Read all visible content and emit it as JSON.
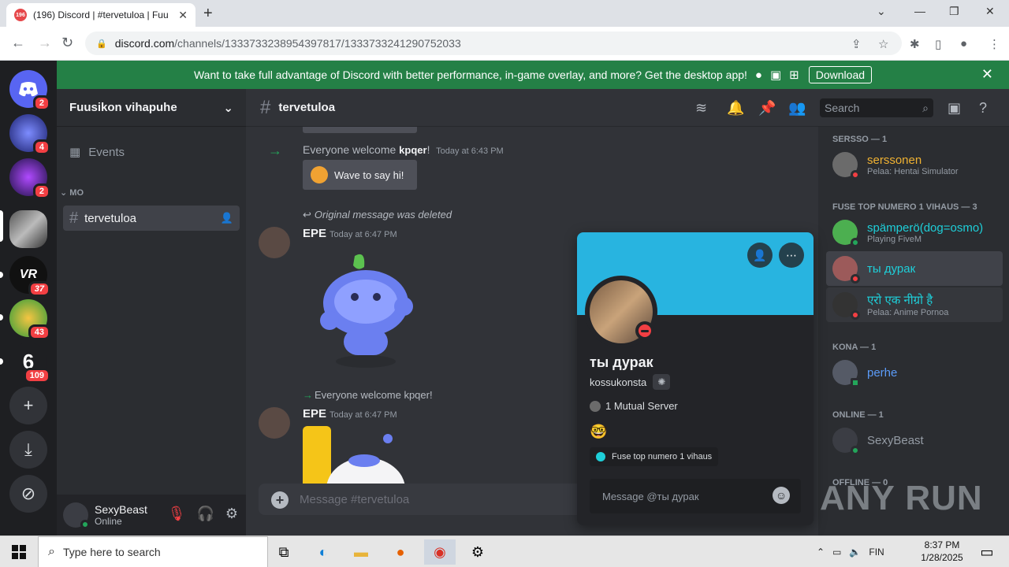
{
  "browser": {
    "tab_title": "(196) Discord | #tervetuloa | Fuu",
    "tab_badge": "196",
    "url_host": "discord.com",
    "url_path": "/channels/1333733238954397817/1333733241290752033"
  },
  "notice": {
    "text": "Want to take full advantage of Discord with better performance, in-game overlay, and more? Get the desktop app!",
    "download_label": "Download"
  },
  "rail": {
    "badges": [
      "2",
      "4",
      "2",
      "37",
      "43",
      "109"
    ]
  },
  "sidebar": {
    "server_name": "Fuusikon vihapuhe",
    "events_label": "Events",
    "category": "MO",
    "channel": "tervetuloa",
    "user": {
      "name": "SexyBeast",
      "status": "Online"
    }
  },
  "header": {
    "channel": "tervetuloa",
    "search_placeholder": "Search"
  },
  "messages": {
    "welcome1_prefix": "Everyone welcome ",
    "welcome1_user": "kpqer",
    "welcome1_suffix": "!",
    "welcome1_time": "Today at 6:43 PM",
    "wave_label": "Wave to say hi!",
    "reply1": "Original message was deleted",
    "msg1_author": "EPE",
    "msg1_time": "Today at 6:47 PM",
    "reply2": "Everyone welcome kpqer!",
    "msg2_author": "EPE",
    "msg2_time": "Today at 6:47 PM",
    "input_placeholder": "Message #tervetuloa"
  },
  "members": {
    "groups": [
      {
        "title": "SERSSO — 1"
      },
      {
        "title": "FUSE TOP NUMERO 1 VIHAUS — 3"
      },
      {
        "title": "KONA — 1"
      },
      {
        "title": "ONLINE — 1"
      },
      {
        "title": "OFFLINE — 0"
      }
    ],
    "items": [
      {
        "name": "serssonen",
        "sub": "Pelaa: Hentai Simulator",
        "color": "#f0b232"
      },
      {
        "name": "spämperö(dog=osmo)",
        "sub": "Playing FiveM",
        "color": "#1ecfd9"
      },
      {
        "name": "ты дурак",
        "sub": "",
        "color": "#1ecfd9"
      },
      {
        "name": "एरो एक नीग्रो है",
        "sub": "Pelaa: Anime Pornoa",
        "color": "#1ecfd9"
      },
      {
        "name": "perhe",
        "sub": "",
        "color": "#5b9bf8"
      },
      {
        "name": "SexyBeast",
        "sub": "",
        "color": "#949ba4"
      }
    ]
  },
  "profile": {
    "display_name": "ты дурак",
    "username": "kossukonsta",
    "mutual": "1 Mutual Server",
    "role": "Fuse top numero 1 vihaus",
    "message_placeholder": "Message @ты дурак"
  },
  "taskbar": {
    "search_placeholder": "Type here to search",
    "lang": "FIN",
    "time": "8:37 PM",
    "date": "1/28/2025"
  },
  "watermark": "ANY RUN"
}
